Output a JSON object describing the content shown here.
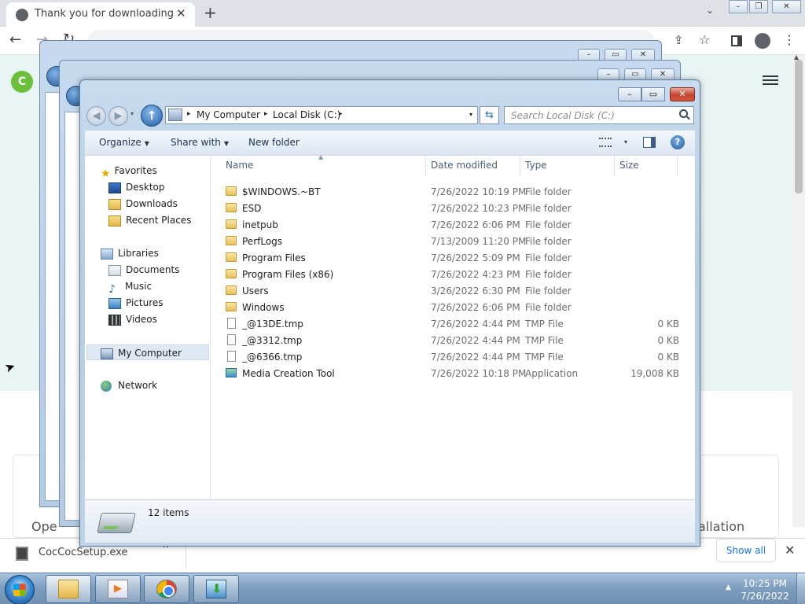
{
  "browser": {
    "tab_title": "Thank you for downloading Cốc Cốc",
    "tab_close": "✕",
    "new_tab": "+",
    "tab_search": "⌄",
    "back": "←",
    "forward": "→",
    "reload": "↻",
    "address": "",
    "share": "⇪",
    "star": "☆",
    "menu": "⋮",
    "window_buttons": {
      "minimize": "–",
      "maximize": "❐",
      "close": "✕"
    }
  },
  "page": {
    "logo_letter": "C",
    "text_left": "Ope",
    "text_right": "allation"
  },
  "downloads_bar": {
    "file_name": "CocCocSetup.exe",
    "chevron": "⌃",
    "show_all": "Show all",
    "close": "✕"
  },
  "explorer": {
    "window_buttons": {
      "minimize": "–",
      "maximize": "▭",
      "close": "✕"
    },
    "nav": {
      "back": "◀",
      "forward": "▶",
      "up": "↑",
      "dropdown": "▾"
    },
    "breadcrumb": [
      "My Computer",
      "Local Disk (C:)"
    ],
    "breadcrumb_arrow": "▸",
    "address_dropdown": "▾",
    "refresh": "⇆",
    "search_placeholder": "Search Local Disk (C:)",
    "toolbar": {
      "organize": "Organize",
      "share_with": "Share with",
      "new_folder": "New folder",
      "caret": "▼",
      "help": "?"
    },
    "nav_pane": {
      "favorites": "Favorites",
      "desktop": "Desktop",
      "downloads": "Downloads",
      "recent_places": "Recent Places",
      "libraries": "Libraries",
      "documents": "Documents",
      "music": "Music",
      "pictures": "Pictures",
      "videos": "Videos",
      "my_computer": "My Computer",
      "network": "Network"
    },
    "columns": {
      "name": "Name",
      "date_modified": "Date modified",
      "type": "Type",
      "size": "Size",
      "sort_indicator": "▲"
    },
    "files": [
      {
        "name": "$WINDOWS.~BT",
        "date": "7/26/2022 10:19 PM",
        "type": "File folder",
        "size": "",
        "icon": "folder-icon"
      },
      {
        "name": "ESD",
        "date": "7/26/2022 10:23 PM",
        "type": "File folder",
        "size": "",
        "icon": "folder-icon"
      },
      {
        "name": "inetpub",
        "date": "7/26/2022 6:06 PM",
        "type": "File folder",
        "size": "",
        "icon": "folder-icon"
      },
      {
        "name": "PerfLogs",
        "date": "7/13/2009 11:20 PM",
        "type": "File folder",
        "size": "",
        "icon": "folder-icon"
      },
      {
        "name": "Program Files",
        "date": "7/26/2022 5:09 PM",
        "type": "File folder",
        "size": "",
        "icon": "folder-icon"
      },
      {
        "name": "Program Files (x86)",
        "date": "7/26/2022 4:23 PM",
        "type": "File folder",
        "size": "",
        "icon": "folder-icon"
      },
      {
        "name": "Users",
        "date": "3/26/2022 6:30 PM",
        "type": "File folder",
        "size": "",
        "icon": "folder-icon"
      },
      {
        "name": "Windows",
        "date": "7/26/2022 6:06 PM",
        "type": "File folder",
        "size": "",
        "icon": "folder-icon"
      },
      {
        "name": "_@13DE.tmp",
        "date": "7/26/2022 4:44 PM",
        "type": "TMP File",
        "size": "0 KB",
        "icon": "tmp-file-icon"
      },
      {
        "name": "_@3312.tmp",
        "date": "7/26/2022 4:44 PM",
        "type": "TMP File",
        "size": "0 KB",
        "icon": "tmp-file-icon"
      },
      {
        "name": "_@6366.tmp",
        "date": "7/26/2022 4:44 PM",
        "type": "TMP File",
        "size": "0 KB",
        "icon": "tmp-file-icon"
      },
      {
        "name": "Media Creation Tool",
        "date": "7/26/2022 10:18 PM",
        "type": "Application",
        "size": "19,008 KB",
        "icon": "application-icon"
      }
    ],
    "item_count": "12 items"
  },
  "taskbar": {
    "time": "10:25 PM",
    "date": "7/26/2022",
    "tray_arrow": "▲"
  },
  "colors": {
    "aero_frame": "#b7cde4",
    "close_button": "#c7422d",
    "taskbar": "#7f9fc0",
    "page_hero": "#e9f5f4",
    "link_blue": "#1a73e8"
  }
}
